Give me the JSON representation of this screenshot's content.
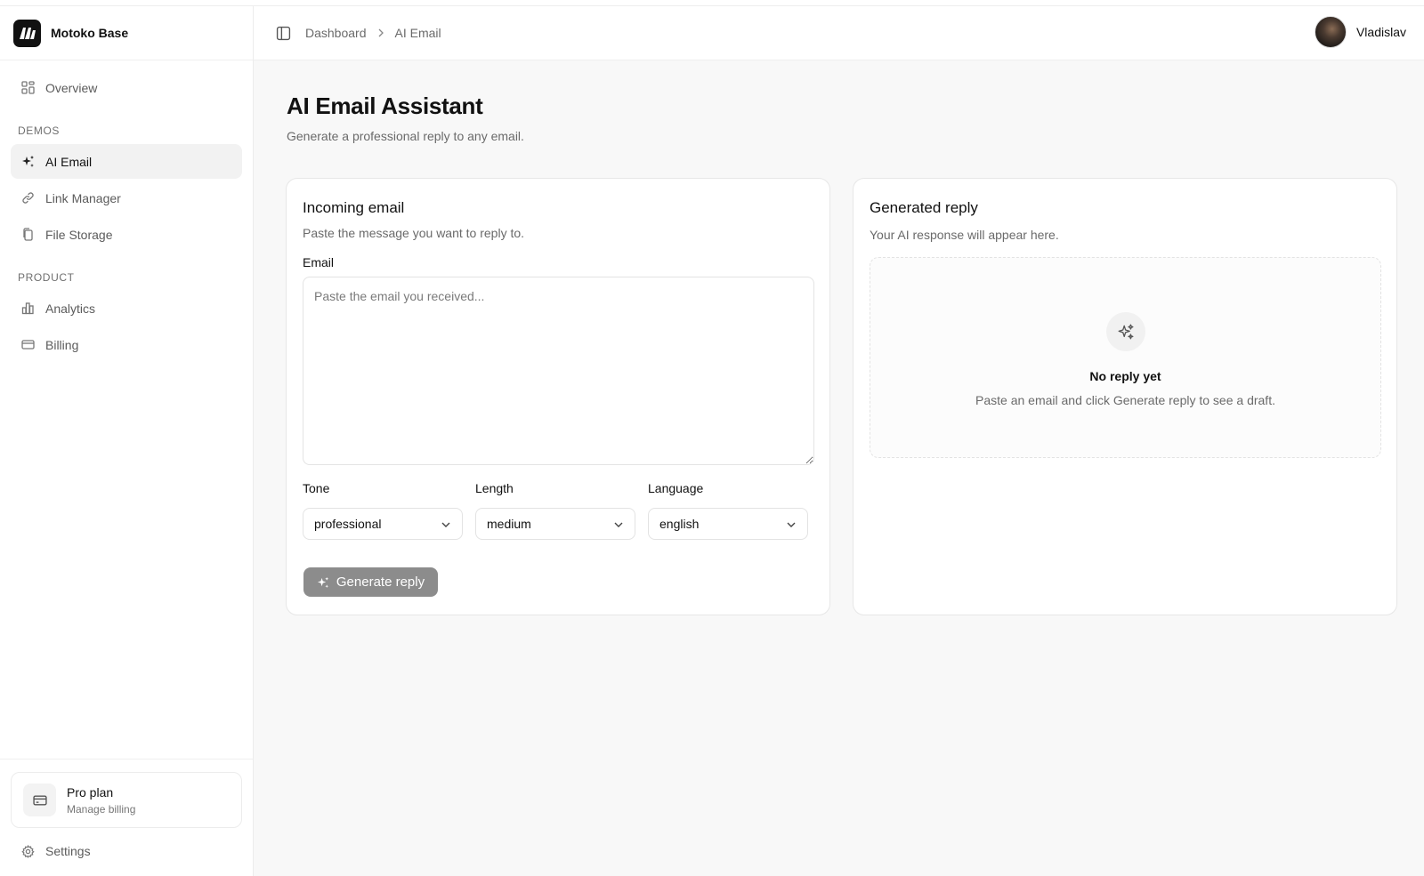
{
  "brand": {
    "name": "Motoko Base"
  },
  "sidebar": {
    "overview_label": "Overview",
    "demos_label": "DEMOS",
    "demos": [
      {
        "label": "AI Email",
        "icon": "sparkle-icon",
        "active": true
      },
      {
        "label": "Link Manager",
        "icon": "link-icon"
      },
      {
        "label": "File Storage",
        "icon": "files-icon"
      }
    ],
    "product_label": "PRODUCT",
    "product": [
      {
        "label": "Analytics",
        "icon": "chart-icon"
      },
      {
        "label": "Billing",
        "icon": "card-icon"
      }
    ],
    "plan": {
      "title": "Pro plan",
      "subtitle": "Manage billing"
    },
    "settings_label": "Settings"
  },
  "header": {
    "breadcrumb": [
      "Dashboard",
      "AI Email"
    ],
    "user_name": "Vladislav"
  },
  "page": {
    "title": "AI Email Assistant",
    "subtitle": "Generate a professional reply to any email."
  },
  "incoming": {
    "title": "Incoming email",
    "subtitle": "Paste the message you want to reply to.",
    "email_label": "Email",
    "email_placeholder": "Paste the email you received...",
    "tone_label": "Tone",
    "tone_value": "professional",
    "length_label": "Length",
    "length_value": "medium",
    "language_label": "Language",
    "language_value": "english",
    "generate_label": "Generate reply"
  },
  "reply": {
    "title": "Generated reply",
    "subtitle": "Your AI response will appear here.",
    "empty_title": "No reply yet",
    "empty_subtitle": "Paste an email and click Generate reply to see a draft."
  },
  "colors": {
    "accent": "#111111",
    "button_disabled": "#8c8c8c",
    "main_bg": "#f8f8f8"
  }
}
